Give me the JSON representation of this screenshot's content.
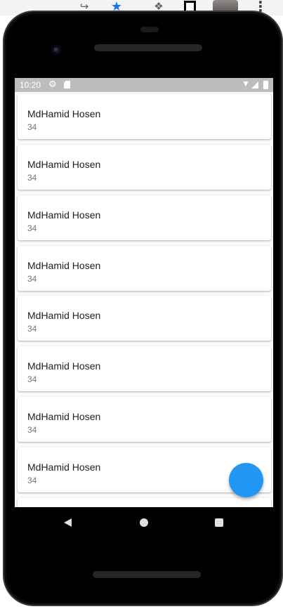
{
  "statusbar": {
    "time": "10:20",
    "icons": [
      "gear-icon",
      "sd-card-icon",
      "wifi-icon",
      "signal-icon",
      "battery-icon"
    ]
  },
  "contacts": [
    {
      "name": "MdHamid Hosen",
      "age": "34"
    },
    {
      "name": "MdHamid Hosen",
      "age": "34"
    },
    {
      "name": "MdHamid Hosen",
      "age": "34"
    },
    {
      "name": "MdHamid Hosen",
      "age": "34"
    },
    {
      "name": "MdHamid Hosen",
      "age": "34"
    },
    {
      "name": "MdHamid Hosen",
      "age": "34"
    },
    {
      "name": "MdHamid Hosen",
      "age": "34"
    },
    {
      "name": "MdHamid Hosen",
      "age": "34"
    }
  ],
  "fab": {
    "icon": "add-icon",
    "color": "#2196f3"
  },
  "navbar": {
    "buttons": [
      "back-icon",
      "home-icon",
      "recents-icon"
    ]
  },
  "colors": {
    "statusbar": "#bdbdbd",
    "background": "#fafafa",
    "accent": "#2196f3"
  }
}
